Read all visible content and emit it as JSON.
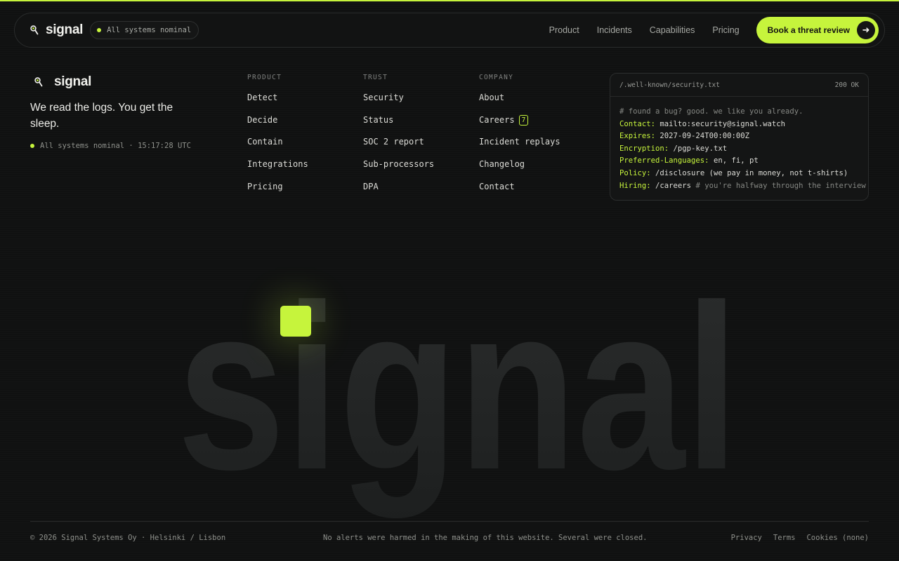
{
  "nav": {
    "brand": "signal",
    "status": "All systems nominal",
    "links": [
      "Product",
      "Incidents",
      "Capabilities",
      "Pricing"
    ],
    "cta_label": "Book a threat review",
    "cta_icon": "arrow-right-icon"
  },
  "brand_block": {
    "brand": "signal",
    "tagline": "We read the logs. You get the sleep.",
    "status": "All systems nominal · 15:17:28 UTC"
  },
  "columns": [
    {
      "heading": "PRODUCT",
      "items": [
        "Detect",
        "Decide",
        "Contain",
        "Integrations",
        "Pricing"
      ]
    },
    {
      "heading": "TRUST",
      "items": [
        "Security",
        "Status",
        "SOC 2 report",
        "Sub-processors",
        "DPA"
      ]
    },
    {
      "heading": "COMPANY",
      "items": [
        "About",
        "Careers",
        "Incident replays",
        "Changelog",
        "Contact"
      ],
      "careers_badge": "7"
    }
  ],
  "security_card": {
    "path": "/.well-known/security.txt",
    "status": "200 OK",
    "comment": "# found a bug? good. we like you already.",
    "lines": [
      {
        "key": "Contact:",
        "value": " mailto:security@signal.watch",
        "note": ""
      },
      {
        "key": "Expires:",
        "value": " 2027-09-24T00:00:00Z",
        "note": ""
      },
      {
        "key": "Encryption:",
        "value": " /pgp-key.txt",
        "note": ""
      },
      {
        "key": "Preferred-Languages:",
        "value": " en, fi, pt",
        "note": ""
      },
      {
        "key": "Policy:",
        "value": " /disclosure (we pay in money, not t-shirts)",
        "note": ""
      },
      {
        "key": "Hiring:",
        "value": " /careers",
        "note": " # you're halfway through the interview"
      }
    ]
  },
  "big_wordmark": "signal",
  "footer": {
    "copyright": "© 2026 Signal Systems Oy · Helsinki / Lisbon",
    "joke": "No alerts were harmed in the making of this website. Several were closed.",
    "links": [
      "Privacy",
      "Terms",
      "Cookies (none)"
    ]
  },
  "colors": {
    "accent": "#c6f43c",
    "background": "#101111",
    "text": "#e8e8e4"
  }
}
